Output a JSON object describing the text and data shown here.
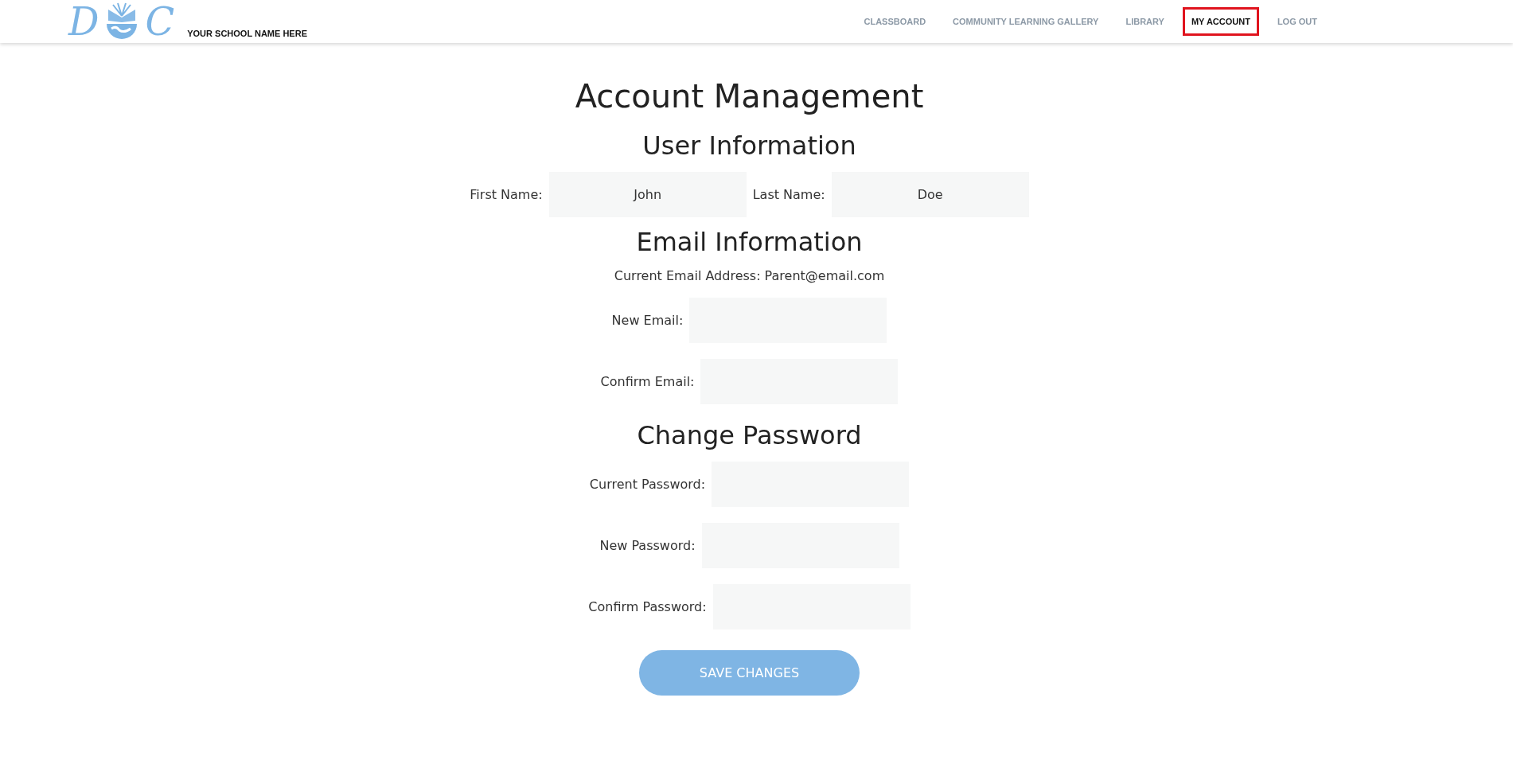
{
  "header": {
    "logo_letters": [
      "D",
      "C"
    ],
    "school_name": "YOUR SCHOOL NAME HERE",
    "nav": [
      {
        "label": "CLASSBOARD",
        "selected": false
      },
      {
        "label": "COMMUNITY LEARNING GALLERY",
        "selected": false
      },
      {
        "label": "LIBRARY",
        "selected": false
      },
      {
        "label": "MY ACCOUNT",
        "selected": true
      },
      {
        "label": "LOG OUT",
        "selected": false
      }
    ]
  },
  "title": "Account Management",
  "sections": [
    {
      "heading": "User Information",
      "kind": "inline",
      "fields": [
        {
          "label": "First Name:",
          "value": "John"
        },
        {
          "label": "Last Name:",
          "value": "Doe"
        }
      ]
    },
    {
      "heading": "Email Information",
      "note": "Current Email Address: Parent@email.com",
      "kind": "stacked",
      "fields": [
        {
          "label": "New Email:"
        },
        {
          "label": "Confirm Email:"
        }
      ]
    },
    {
      "heading": "Change Password",
      "kind": "stacked",
      "fields": [
        {
          "label": "Current Password:"
        },
        {
          "label": "New Password:"
        },
        {
          "label": "Confirm Password:"
        }
      ]
    }
  ],
  "save_button": "SAVE CHANGES"
}
